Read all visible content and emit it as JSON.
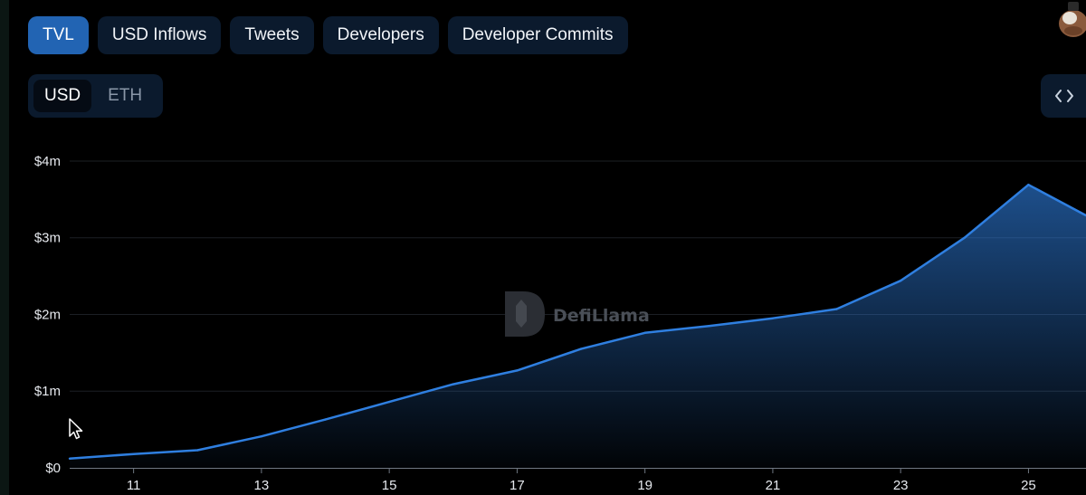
{
  "tabs": [
    {
      "label": "TVL",
      "active": true
    },
    {
      "label": "USD Inflows",
      "active": false
    },
    {
      "label": "Tweets",
      "active": false
    },
    {
      "label": "Developers",
      "active": false
    },
    {
      "label": "Developer Commits",
      "active": false
    }
  ],
  "denomination": {
    "options": [
      {
        "label": "USD",
        "active": true
      },
      {
        "label": "ETH",
        "active": false
      }
    ]
  },
  "embed_button": {
    "icon": "code-icon"
  },
  "watermark": {
    "text": "DefiLlama"
  },
  "colors": {
    "line": "#2f7fe0",
    "active_tab": "#2264b3",
    "tab_bg": "#0b1a2d",
    "background": "#000000"
  },
  "chart_data": {
    "type": "area",
    "title": "",
    "xlabel": "",
    "ylabel": "",
    "x": [
      10,
      11,
      12,
      13,
      14,
      15,
      16,
      17,
      18,
      19,
      20,
      21,
      22,
      23,
      24,
      25,
      25.9
    ],
    "series": [
      {
        "values": [
          0.12,
          0.18,
          0.23,
          0.41,
          0.63,
          0.86,
          1.09,
          1.27,
          1.55,
          1.76,
          1.85,
          1.95,
          2.07,
          2.44,
          3.0,
          3.69,
          3.29
        ]
      }
    ],
    "xlim": [
      10,
      25.9
    ],
    "ylim": [
      0,
      4.2
    ],
    "x_ticks": [
      11,
      13,
      15,
      17,
      19,
      21,
      23,
      25
    ],
    "x_tick_labels": [
      "11",
      "13",
      "15",
      "17",
      "19",
      "21",
      "23",
      "25"
    ],
    "y_ticks": [
      0,
      1,
      2,
      3,
      4
    ],
    "y_tick_labels": [
      "$0",
      "$1m",
      "$2m",
      "$3m",
      "$4m"
    ],
    "grid": true,
    "legend": "none"
  }
}
